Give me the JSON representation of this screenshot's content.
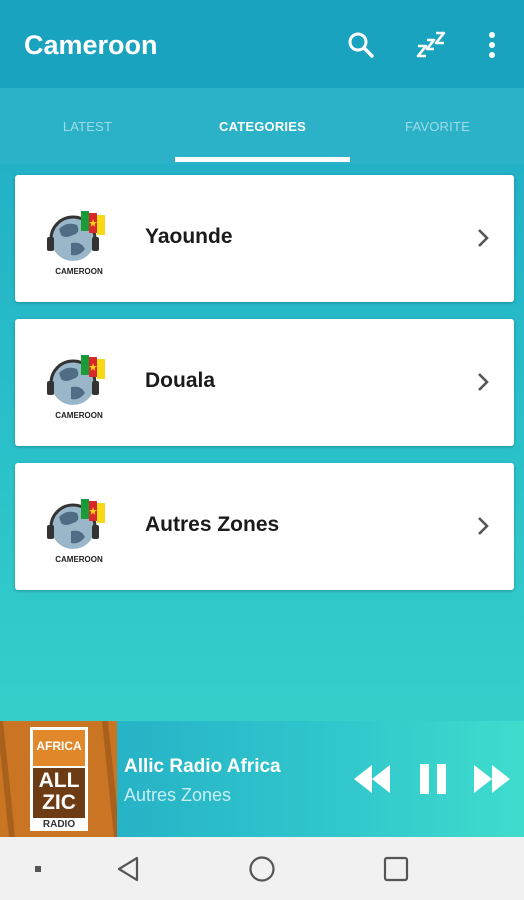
{
  "app_bar": {
    "title": "Cameroon",
    "icons": [
      "search-icon",
      "sleep-timer-icon",
      "more-vert-icon"
    ]
  },
  "tabs": [
    {
      "label": "LATEST",
      "active": false
    },
    {
      "label": "CATEGORIES",
      "active": true
    },
    {
      "label": "FAVORITE",
      "active": false
    }
  ],
  "categories": [
    {
      "label": "Yaounde",
      "logo_caption": "CAMEROON"
    },
    {
      "label": "Douala",
      "logo_caption": "CAMEROON"
    },
    {
      "label": "Autres Zones",
      "logo_caption": "CAMEROON"
    }
  ],
  "player": {
    "station": "Allic Radio Africa",
    "category": "Autres Zones",
    "art": {
      "line1": "AFRICA",
      "line2": "ALL",
      "line3": "ZIC",
      "line4": "RADIO"
    },
    "controls": [
      "rewind-icon",
      "pause-icon",
      "fast-forward-icon"
    ]
  },
  "colors": {
    "app_bar": "#1aa3bf",
    "tab_bar": "#2bb1c8",
    "background_start": "#1ea8c4",
    "background_end": "#3dd8cc",
    "card": "#ffffff",
    "art_orange": "#c97524"
  }
}
